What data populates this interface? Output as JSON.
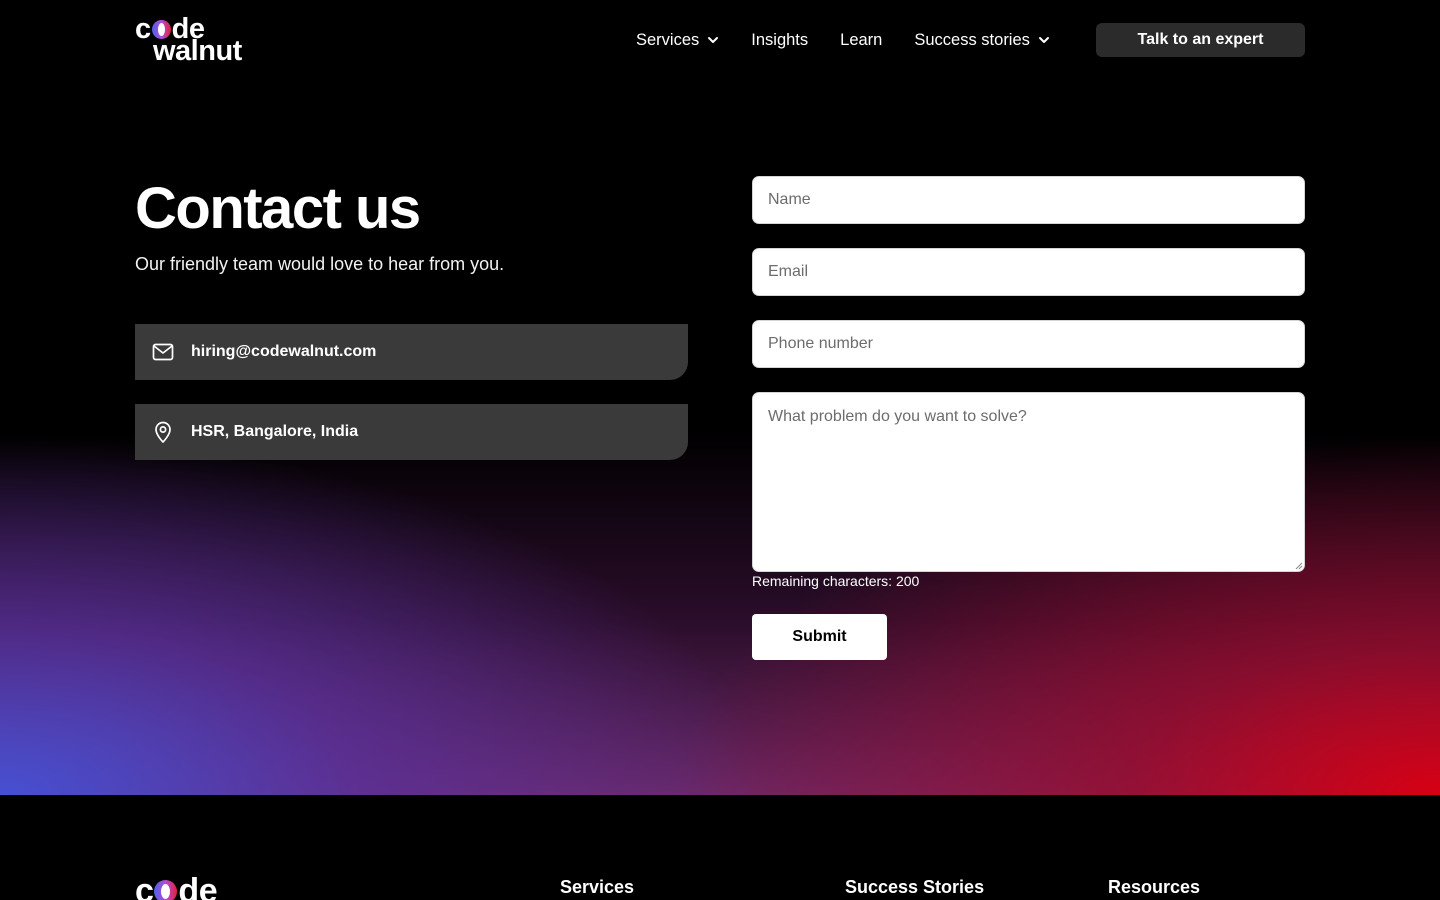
{
  "header": {
    "logo": {
      "line1_left": "c",
      "line1_right": "de",
      "line2": "walnut"
    },
    "nav": [
      {
        "label": "Services",
        "has_dropdown": true
      },
      {
        "label": "Insights",
        "has_dropdown": false
      },
      {
        "label": "Learn",
        "has_dropdown": false
      },
      {
        "label": "Success stories",
        "has_dropdown": true
      }
    ],
    "cta_label": "Talk to an expert"
  },
  "contact": {
    "title": "Contact us",
    "subtitle": "Our friendly team would love to hear from you.",
    "email": {
      "icon": "mail-icon",
      "text": "hiring@codewalnut.com"
    },
    "location": {
      "icon": "map-pin-icon",
      "text": "HSR, Bangalore, India"
    }
  },
  "form": {
    "name_placeholder": "Name",
    "email_placeholder": "Email",
    "phone_placeholder": "Phone number",
    "problem_placeholder": "What problem do you want to solve?",
    "remaining_text": "Remaining characters: 200",
    "submit_label": "Submit"
  },
  "footer": {
    "logo_left": "c",
    "logo_right": "de",
    "columns": [
      "Services",
      "Success Stories",
      "Resources"
    ]
  },
  "colors": {
    "background": "#000000",
    "card": "#3a3a3a",
    "cta": "#2b2b2b",
    "gradient_red": "#d70014",
    "gradient_blue": "#4650d2"
  }
}
